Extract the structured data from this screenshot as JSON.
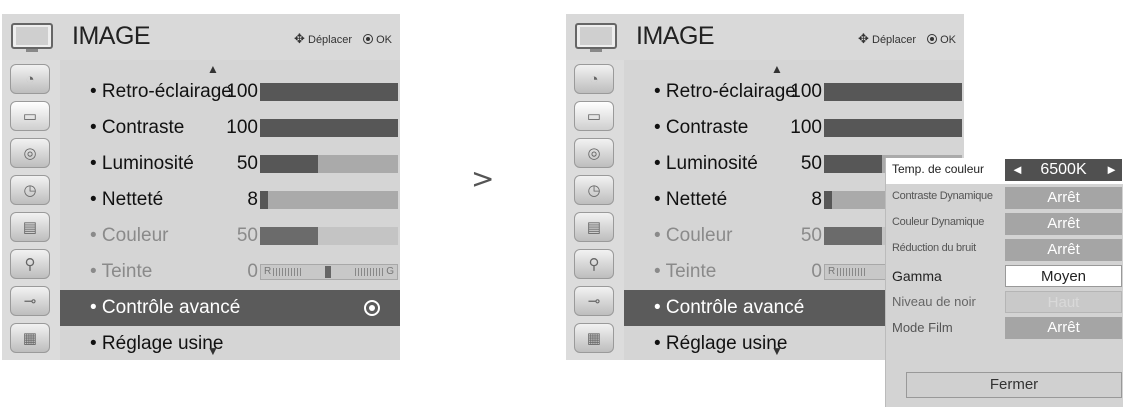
{
  "separator": ">",
  "left": {
    "header": {
      "title": "IMAGE",
      "move_label": "Déplacer",
      "ok_label": "OK",
      "move_icon": "four-way-arrows-icon",
      "ok_icon": "ok-dot-icon"
    },
    "sidebar_icons": [
      "image-icon",
      "picture-icon",
      "audio-icon",
      "clock-icon",
      "lock-option-icon",
      "input-icon",
      "usb-icon",
      "photo-icon"
    ],
    "menu": {
      "scroll_up": "▲",
      "scroll_down": "▼",
      "items": [
        {
          "label": "• Retro-éclairage",
          "value": "100",
          "level": 100
        },
        {
          "label": "• Contraste",
          "value": "100",
          "level": 100
        },
        {
          "label": "• Luminosité",
          "value": "50",
          "level": 50
        },
        {
          "label": "• Netteté",
          "value": "8",
          "level": 8
        },
        {
          "label": "• Couleur",
          "value": "50",
          "level": 50
        },
        {
          "label": "• Teinte",
          "value": "0",
          "tint_left": "R",
          "tint_right": "G"
        },
        {
          "label": "• Contrôle avancé"
        },
        {
          "label": "• Réglage usine"
        }
      ]
    }
  },
  "right": {
    "header": {
      "title": "IMAGE",
      "move_label": "Déplacer",
      "ok_label": "OK"
    },
    "menu": {
      "scroll_up": "▲",
      "scroll_down": "▼",
      "items": [
        {
          "label": "• Retro-éclairage",
          "value": "100"
        },
        {
          "label": "• Contraste",
          "value": "100"
        },
        {
          "label": "• Luminosité",
          "value": "50"
        },
        {
          "label": "• Netteté",
          "value": "8"
        },
        {
          "label": "• Couleur",
          "value": "50"
        },
        {
          "label": "• Teinte",
          "value": "0",
          "tint_left": "R"
        },
        {
          "label": "• Contrôle avancé"
        },
        {
          "label": "• Réglage usine"
        }
      ]
    },
    "popup": {
      "rows": [
        {
          "label": "Temp. de couleur",
          "value": "6500K",
          "left_arrow": "◄",
          "right_arrow": "►"
        },
        {
          "label": "Contraste Dynamique",
          "value": "Arrêt"
        },
        {
          "label": "Couleur Dynamique",
          "value": "Arrêt"
        },
        {
          "label": "Réduction du bruit",
          "value": "Arrêt"
        },
        {
          "label": "Gamma",
          "value": "Moyen"
        },
        {
          "label": "Niveau de noir",
          "value": "Haut"
        },
        {
          "label": "Mode Film",
          "value": "Arrêt"
        }
      ],
      "close_label": "Fermer"
    }
  }
}
